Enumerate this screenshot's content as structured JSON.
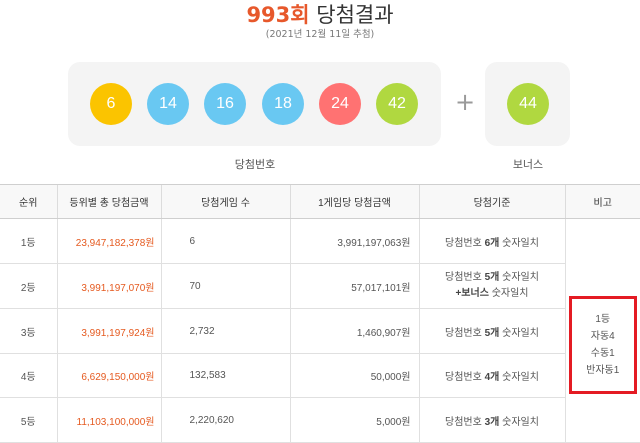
{
  "header": {
    "round": "993회",
    "title": "당첨결과",
    "draw_date": "(2021년 12월 11일 추첨)"
  },
  "winning": {
    "label": "당첨번호",
    "numbers": [
      "6",
      "14",
      "16",
      "18",
      "24",
      "42"
    ],
    "colors": [
      "#fbc400",
      "#69c8f2",
      "#69c8f2",
      "#69c8f2",
      "#ff7272",
      "#b0d840"
    ]
  },
  "plus_sign": "+",
  "bonus": {
    "label": "보너스",
    "number": "44",
    "color": "#b0d840"
  },
  "table": {
    "headers": [
      "순위",
      "등위별 총 당첨금액",
      "당첨게임 수",
      "1게임당 당첨금액",
      "당첨기준",
      "비고"
    ],
    "rows": [
      {
        "rank": "1등",
        "total": "23,947,182,378원",
        "games": "6",
        "per_game": "3,991,197,063원",
        "criteria_pre": "당첨번호 ",
        "criteria_bold": "6개",
        "criteria_post": " 숫자일치",
        "criteria_line2_bold": "",
        "criteria_line2_post": ""
      },
      {
        "rank": "2등",
        "total": "3,991,197,070원",
        "games": "70",
        "per_game": "57,017,101원",
        "criteria_pre": "당첨번호 ",
        "criteria_bold": "5개",
        "criteria_post": " 숫자일치",
        "criteria_line2_bold": "+보너스",
        "criteria_line2_post": " 숫자일치"
      },
      {
        "rank": "3등",
        "total": "3,991,197,924원",
        "games": "2,732",
        "per_game": "1,460,907원",
        "criteria_pre": "당첨번호 ",
        "criteria_bold": "5개",
        "criteria_post": " 숫자일치",
        "criteria_line2_bold": "",
        "criteria_line2_post": ""
      },
      {
        "rank": "4등",
        "total": "6,629,150,000원",
        "games": "132,583",
        "per_game": "50,000원",
        "criteria_pre": "당첨번호 ",
        "criteria_bold": "4개",
        "criteria_post": " 숫자일치",
        "criteria_line2_bold": "",
        "criteria_line2_post": ""
      },
      {
        "rank": "5등",
        "total": "11,103,100,000원",
        "games": "2,220,620",
        "per_game": "5,000원",
        "criteria_pre": "당첨번호 ",
        "criteria_bold": "3개",
        "criteria_post": " 숫자일치",
        "criteria_line2_bold": "",
        "criteria_line2_post": ""
      }
    ],
    "note_lines": [
      "1등",
      "자동4",
      "수동1",
      "반자동1"
    ]
  }
}
